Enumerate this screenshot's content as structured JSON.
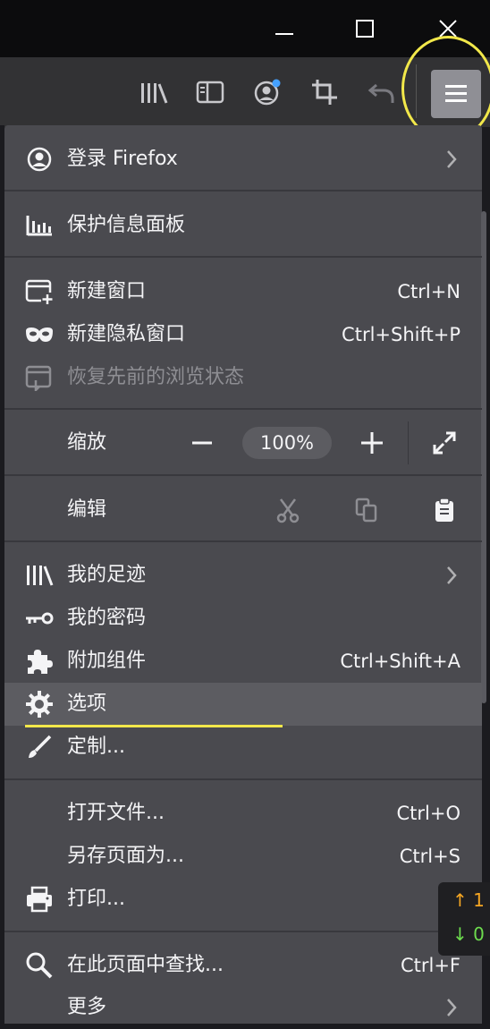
{
  "menu": {
    "sign_in": "登录 Firefox",
    "protection": "保护信息面板",
    "new_window": {
      "label": "新建窗口",
      "shortcut": "Ctrl+N"
    },
    "new_private": {
      "label": "新建隐私窗口",
      "shortcut": "Ctrl+Shift+P"
    },
    "restore": "恢复先前的浏览状态",
    "zoom": {
      "label": "缩放",
      "value": "100%"
    },
    "edit": {
      "label": "编辑"
    },
    "library": "我的足迹",
    "logins": "我的密码",
    "addons": {
      "label": "附加组件",
      "shortcut": "Ctrl+Shift+A"
    },
    "options": "选项",
    "customize": "定制...",
    "open_file": {
      "label": "打开文件...",
      "shortcut": "Ctrl+O"
    },
    "save_as": {
      "label": "另存页面为...",
      "shortcut": "Ctrl+S"
    },
    "print": "打印...",
    "find": {
      "label": "在此页面中查找...",
      "shortcut": "Ctrl+F"
    },
    "more": "更多"
  },
  "overlay": {
    "up": "↑ 1",
    "down": "↓ 0"
  },
  "colors": {
    "highlight": "#f2e84a",
    "menu_bg": "#4a4a4f",
    "hover_bg": "#5c5c61",
    "notify_dot": "#45a1ff"
  }
}
